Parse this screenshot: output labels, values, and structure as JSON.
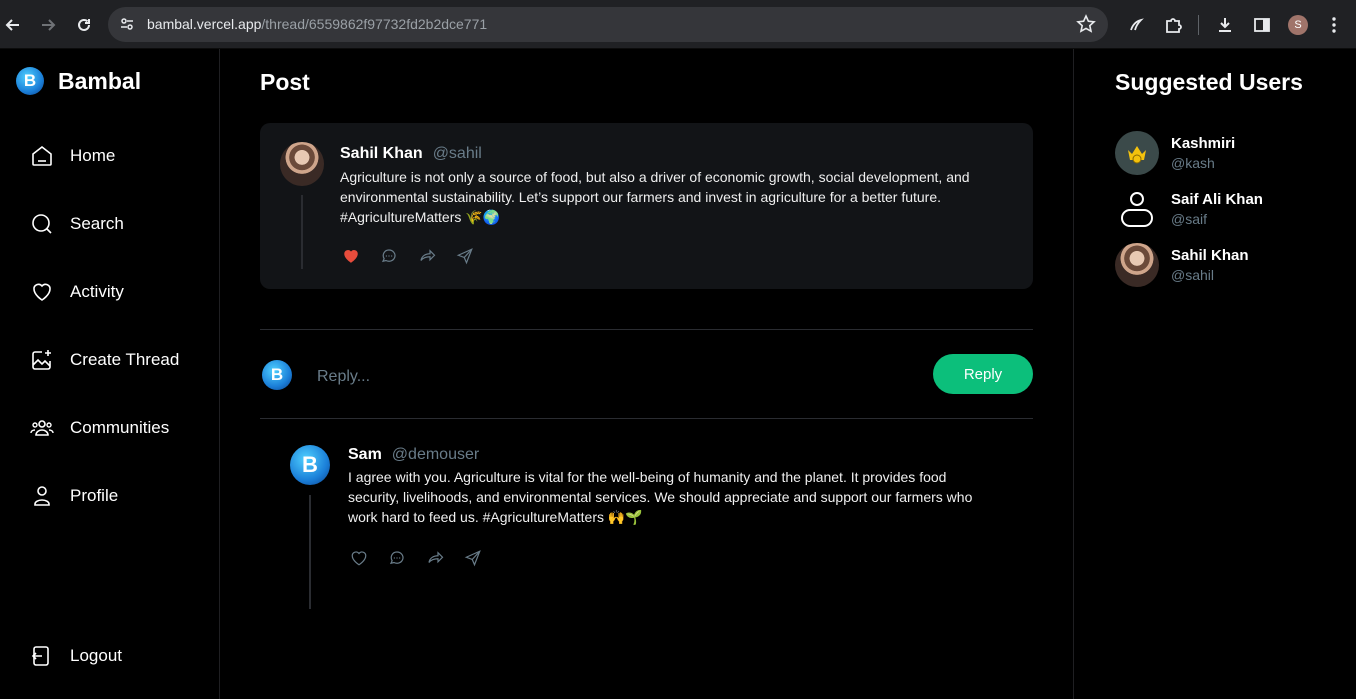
{
  "browser": {
    "url_host": "bambal.vercel.app",
    "url_path": "/thread/6559862f97732fd2b2dce771",
    "profile_initial": "S"
  },
  "brand": {
    "logo_letter": "B",
    "name": "Bambal"
  },
  "nav": {
    "items": [
      {
        "label": "Home",
        "icon": "home-icon"
      },
      {
        "label": "Search",
        "icon": "search-icon"
      },
      {
        "label": "Activity",
        "icon": "heart-icon"
      },
      {
        "label": "Create Thread",
        "icon": "image-plus-icon"
      },
      {
        "label": "Communities",
        "icon": "users-icon"
      },
      {
        "label": "Profile",
        "icon": "user-icon"
      }
    ],
    "logout": "Logout"
  },
  "main": {
    "title": "Post",
    "post": {
      "author": "Sahil Khan",
      "handle": "@sahil",
      "text": "Agriculture is not only a source of food, but also a driver of economic growth, social development, and environmental sustainability. Let’s support our farmers and invest in agriculture for a better future. #AgricultureMatters 🌾🌍",
      "liked": true
    },
    "reply": {
      "placeholder": "Reply...",
      "button": "Reply"
    },
    "comments": [
      {
        "author": "Sam",
        "handle": "@demouser",
        "text": "I agree with you. Agriculture is vital for the well-being of humanity and the planet. It provides food security, livelihoods, and environmental services. We should appreciate and support our farmers who work hard to feed us. #AgricultureMatters 🙌🌱",
        "liked": false
      }
    ]
  },
  "suggested": {
    "title": "Suggested Users",
    "users": [
      {
        "name": "Kashmiri",
        "handle": "@kash"
      },
      {
        "name": "Saif Ali Khan",
        "handle": "@saif"
      },
      {
        "name": "Sahil Khan",
        "handle": "@sahil"
      }
    ]
  },
  "colors": {
    "accent": "#0cbf7b",
    "card": "#121417",
    "muted": "#697c89",
    "like": "#e74c3c"
  }
}
